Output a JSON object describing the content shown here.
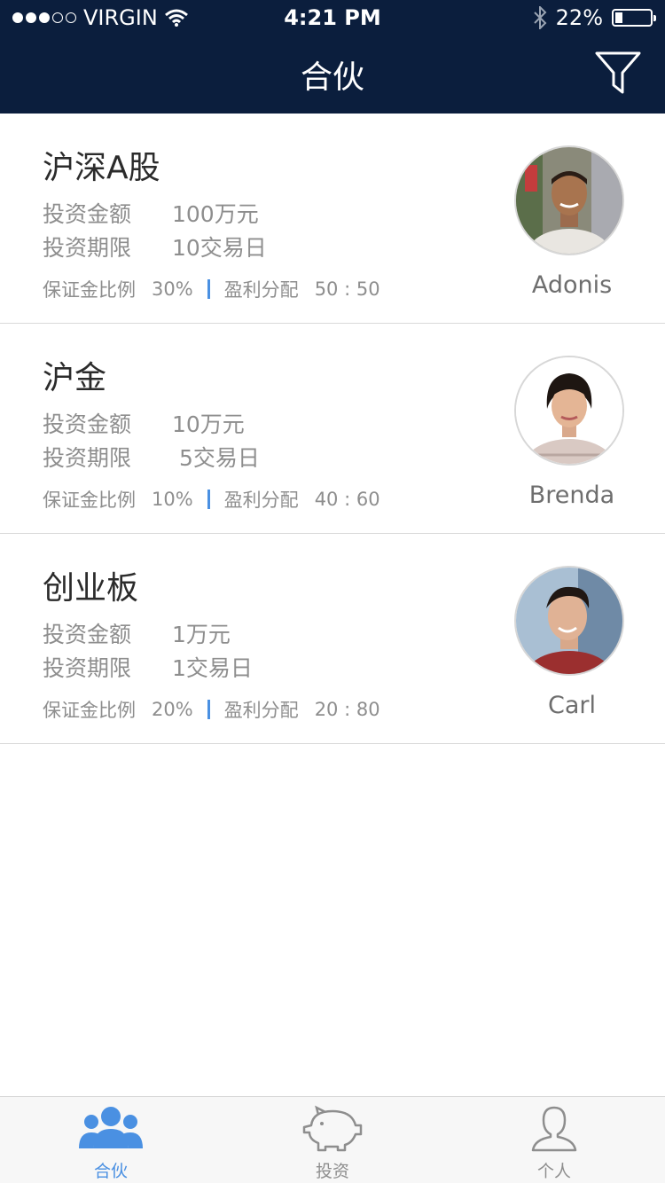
{
  "status_bar": {
    "carrier": "VIRGIN",
    "time": "4:21 PM",
    "battery": "22%",
    "battery_level": 0.22
  },
  "nav": {
    "title": "合伙",
    "filter_icon": "filter-icon"
  },
  "list": {
    "items": [
      {
        "title": "沪深A股",
        "amount_label": "投资金额",
        "amount_value": "100万元",
        "term_label": "投资期限",
        "term_value": "10交易日",
        "margin_label": "保证金比例",
        "margin_value": "30%",
        "profit_label": "盈利分配",
        "profit_value": "50 : 50",
        "name": "Adonis"
      },
      {
        "title": "沪金",
        "amount_label": "投资金额",
        "amount_value": "10万元",
        "term_label": "投资期限",
        "term_value": "5交易日",
        "margin_label": "保证金比例",
        "margin_value": "10%",
        "profit_label": "盈利分配",
        "profit_value": "40 : 60",
        "name": "Brenda"
      },
      {
        "title": "创业板",
        "amount_label": "投资金额",
        "amount_value": "1万元",
        "term_label": "投资期限",
        "term_value": "1交易日",
        "margin_label": "保证金比例",
        "margin_value": "20%",
        "profit_label": "盈利分配",
        "profit_value": "20 : 80",
        "name": "Carl"
      }
    ]
  },
  "tabs": [
    {
      "label": "合伙",
      "icon": "group-icon",
      "active": true
    },
    {
      "label": "投资",
      "icon": "piggy-bank-icon",
      "active": false
    },
    {
      "label": "个人",
      "icon": "person-icon",
      "active": false
    }
  ],
  "colors": {
    "header_bg": "#0b1e3d",
    "accent": "#4a90e2",
    "text_muted": "#8e8e8e"
  }
}
